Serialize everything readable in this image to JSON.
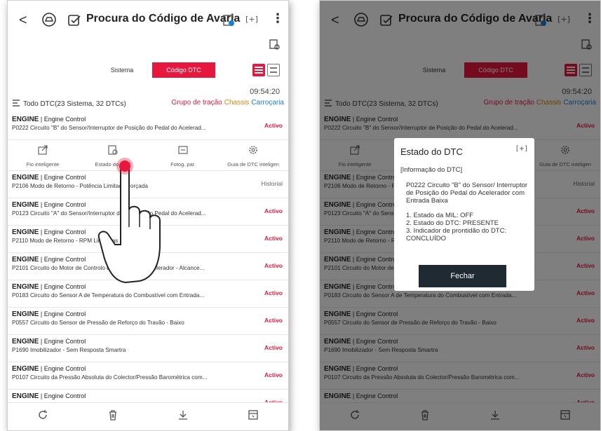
{
  "header": {
    "back_label": "<",
    "title": "Procura do Código de Avaria",
    "expand_label": "[+]",
    "menu_label": "⋮"
  },
  "tabs": [
    {
      "label": "Sistema",
      "selected": false
    },
    {
      "label": "Código DTC",
      "selected": true
    }
  ],
  "time": "09:54:20",
  "summary": {
    "text": "Todo DTC(23 Sistema, 32 DTCs)",
    "groups": [
      "Grupo de tração",
      "Chassis",
      "Carroçaria"
    ]
  },
  "colors": {
    "accent": "#e8173d",
    "chassis": "#d4860b",
    "body": "#1a7fd6"
  },
  "dtcs": [
    {
      "system": "ENGINE",
      "module": "Engine Control",
      "desc": "P0222 Circuito \"B\" do Sensor/Interruptor de Posição do Pedal do Acelerad...",
      "status": "Activo"
    },
    {
      "system": "ENGINE",
      "module": "Engine Control",
      "desc": "P2106 Modo de Retorno - Potência Limitada Forçada",
      "status": "Historial"
    },
    {
      "system": "ENGINE",
      "module": "Engine Control",
      "desc": "P0123 Circuito \"A\" do Sensor/Interruptor de Posição do Pedal do Acelerad...",
      "status": "Activo"
    },
    {
      "system": "ENGINE",
      "module": "Engine Control",
      "desc": "P2110 Modo de Retorno - RPM Limitadas Forçadas",
      "status": "Activo"
    },
    {
      "system": "ENGINE",
      "module": "Engine Control",
      "desc": "P2101 Circuito do Motor de Controlo do Actuador do Acelerador - Alcance...",
      "status": "Activo"
    },
    {
      "system": "ENGINE",
      "module": "Engine Control",
      "desc": "P0183 Circuito do Sensor A de Temperatura do Combustível com Entrada...",
      "status": "Activo"
    },
    {
      "system": "ENGINE",
      "module": "Engine Control",
      "desc": "P0557 Circuito do Sensor de Pressão de Reforço do Travão - Baixo",
      "status": "Activo"
    },
    {
      "system": "ENGINE",
      "module": "Engine Control",
      "desc": "P1690 Imobilizador - Sem Resposta Smartra",
      "status": "Activo"
    },
    {
      "system": "ENGINE",
      "module": "Engine Control",
      "desc": "P0107 Circuito da Pressão Absoluta do Colector/Pressão Barométrica com...",
      "status": "Activo"
    },
    {
      "system": "ENGINE",
      "module": "Engine Control",
      "desc": "",
      "status": "Activo"
    }
  ],
  "row_actions": [
    {
      "label": "Fio inteligente",
      "icon": "share-icon"
    },
    {
      "label": "Estado do DTC",
      "icon": "dtc-state-icon"
    },
    {
      "label": "Fotog. par.",
      "icon": "freeze-frame-icon"
    },
    {
      "label": "Guia de DTC inteligen",
      "icon": "gear-icon"
    }
  ],
  "bottom_bar": [
    {
      "icon": "refresh-icon"
    },
    {
      "icon": "trash-icon"
    },
    {
      "icon": "download-icon"
    },
    {
      "icon": "report-icon"
    }
  ],
  "dialog": {
    "title": "Estado do DTC",
    "expand_label": "[+]",
    "info_header": "[Informação do DTC]",
    "code_line": "P0222  Circuito \"B\" do Sensor/ Interruptor de Posição do Pedal do Acelerador com Entrada Baixa",
    "items": [
      "1. Estado da MIL: OFF",
      "2. Estado do DTC: PRESENTE",
      "3. Indicador de prontidão do DTC: CONCLUÍDO"
    ],
    "close_label": "Fechar"
  }
}
